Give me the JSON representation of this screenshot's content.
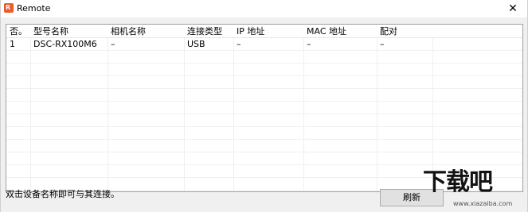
{
  "window": {
    "title": "Remote",
    "close_glyph": "✕",
    "app_icon_letter": "R"
  },
  "table": {
    "columns": [
      "否。",
      "型号名称",
      "相机名称",
      "连接类型",
      "IP 地址",
      "MAC 地址",
      "配对"
    ],
    "rows": [
      [
        "1",
        "DSC-RX100M6",
        "–",
        "USB",
        "–",
        "–",
        "–"
      ]
    ],
    "empty_row_count": 11
  },
  "status_text": "双击设备名称即可与其连接。",
  "refresh_label": "刷新",
  "watermark": {
    "text": "下载吧",
    "url": "www.xiazaiba.com"
  },
  "colors": {
    "app_icon": "#ea5b2a",
    "window_bg": "#f0f0f0",
    "grid_line": "#efefef"
  },
  "icons": {
    "app": "remote-app-icon",
    "close": "close-icon"
  }
}
